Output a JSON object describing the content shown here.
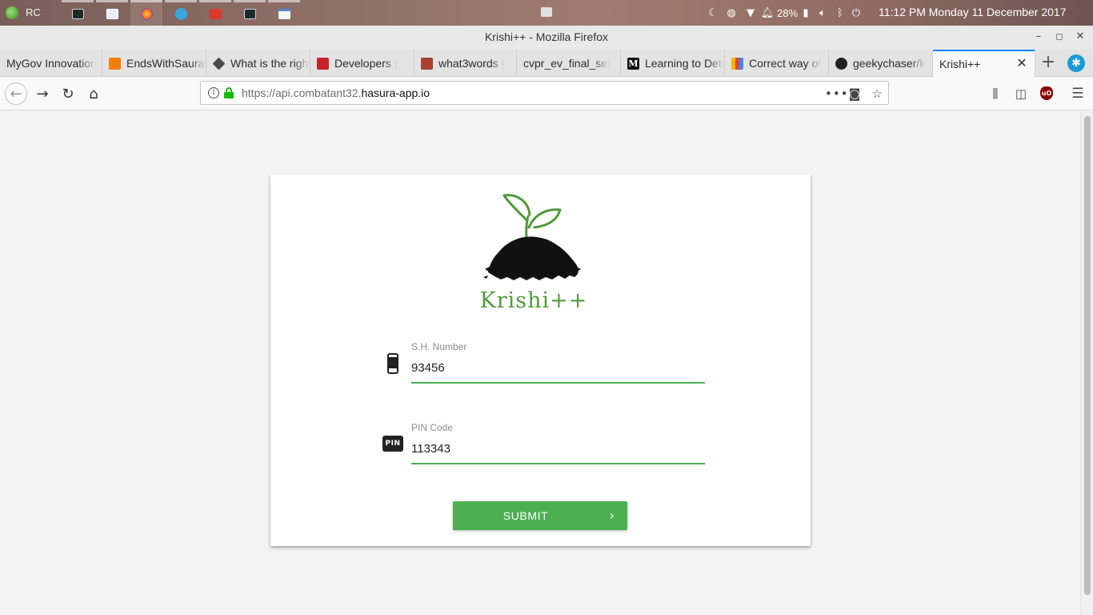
{
  "os_panel": {
    "user": "RC",
    "battery": "28%",
    "clock": "11:12 PM  Monday 11 December 2017"
  },
  "window": {
    "title": "Krishi++ - Mozilla Firefox"
  },
  "tabs": [
    {
      "label": "MyGov Innovation",
      "icon": "mygov-icon"
    },
    {
      "label": "EndsWithSaurabh",
      "icon": "blogger-icon"
    },
    {
      "label": "What is the right",
      "icon": "cube-icon"
    },
    {
      "label": "Developers | ",
      "icon": "developers-icon"
    },
    {
      "label": "what3words | ",
      "icon": "what3words-icon"
    },
    {
      "label": "cvpr_ev_final_sel",
      "icon": ""
    },
    {
      "label": "Learning to Dete",
      "icon": "medium-icon"
    },
    {
      "label": "Correct way of",
      "icon": "chart-icon"
    },
    {
      "label": "geekychaser/k",
      "icon": "github-icon"
    },
    {
      "label": "Krishi++",
      "icon": ""
    }
  ],
  "urlbar": {
    "prefix": "https://api.combatant32.",
    "host": "hasura-app.io"
  },
  "app": {
    "logo_text": "Krishi++",
    "colors": {
      "accent": "#4caf50",
      "logo_green": "#4f9a3a"
    },
    "fields": {
      "sh_number": {
        "label": "S.H. Number",
        "value": "93456",
        "icon": "phone-icon"
      },
      "pin_code": {
        "label": "PIN Code",
        "value": "113343",
        "icon_text": "PIN"
      }
    },
    "submit_label": "SUBMIT",
    "submit_chevron": "›"
  }
}
